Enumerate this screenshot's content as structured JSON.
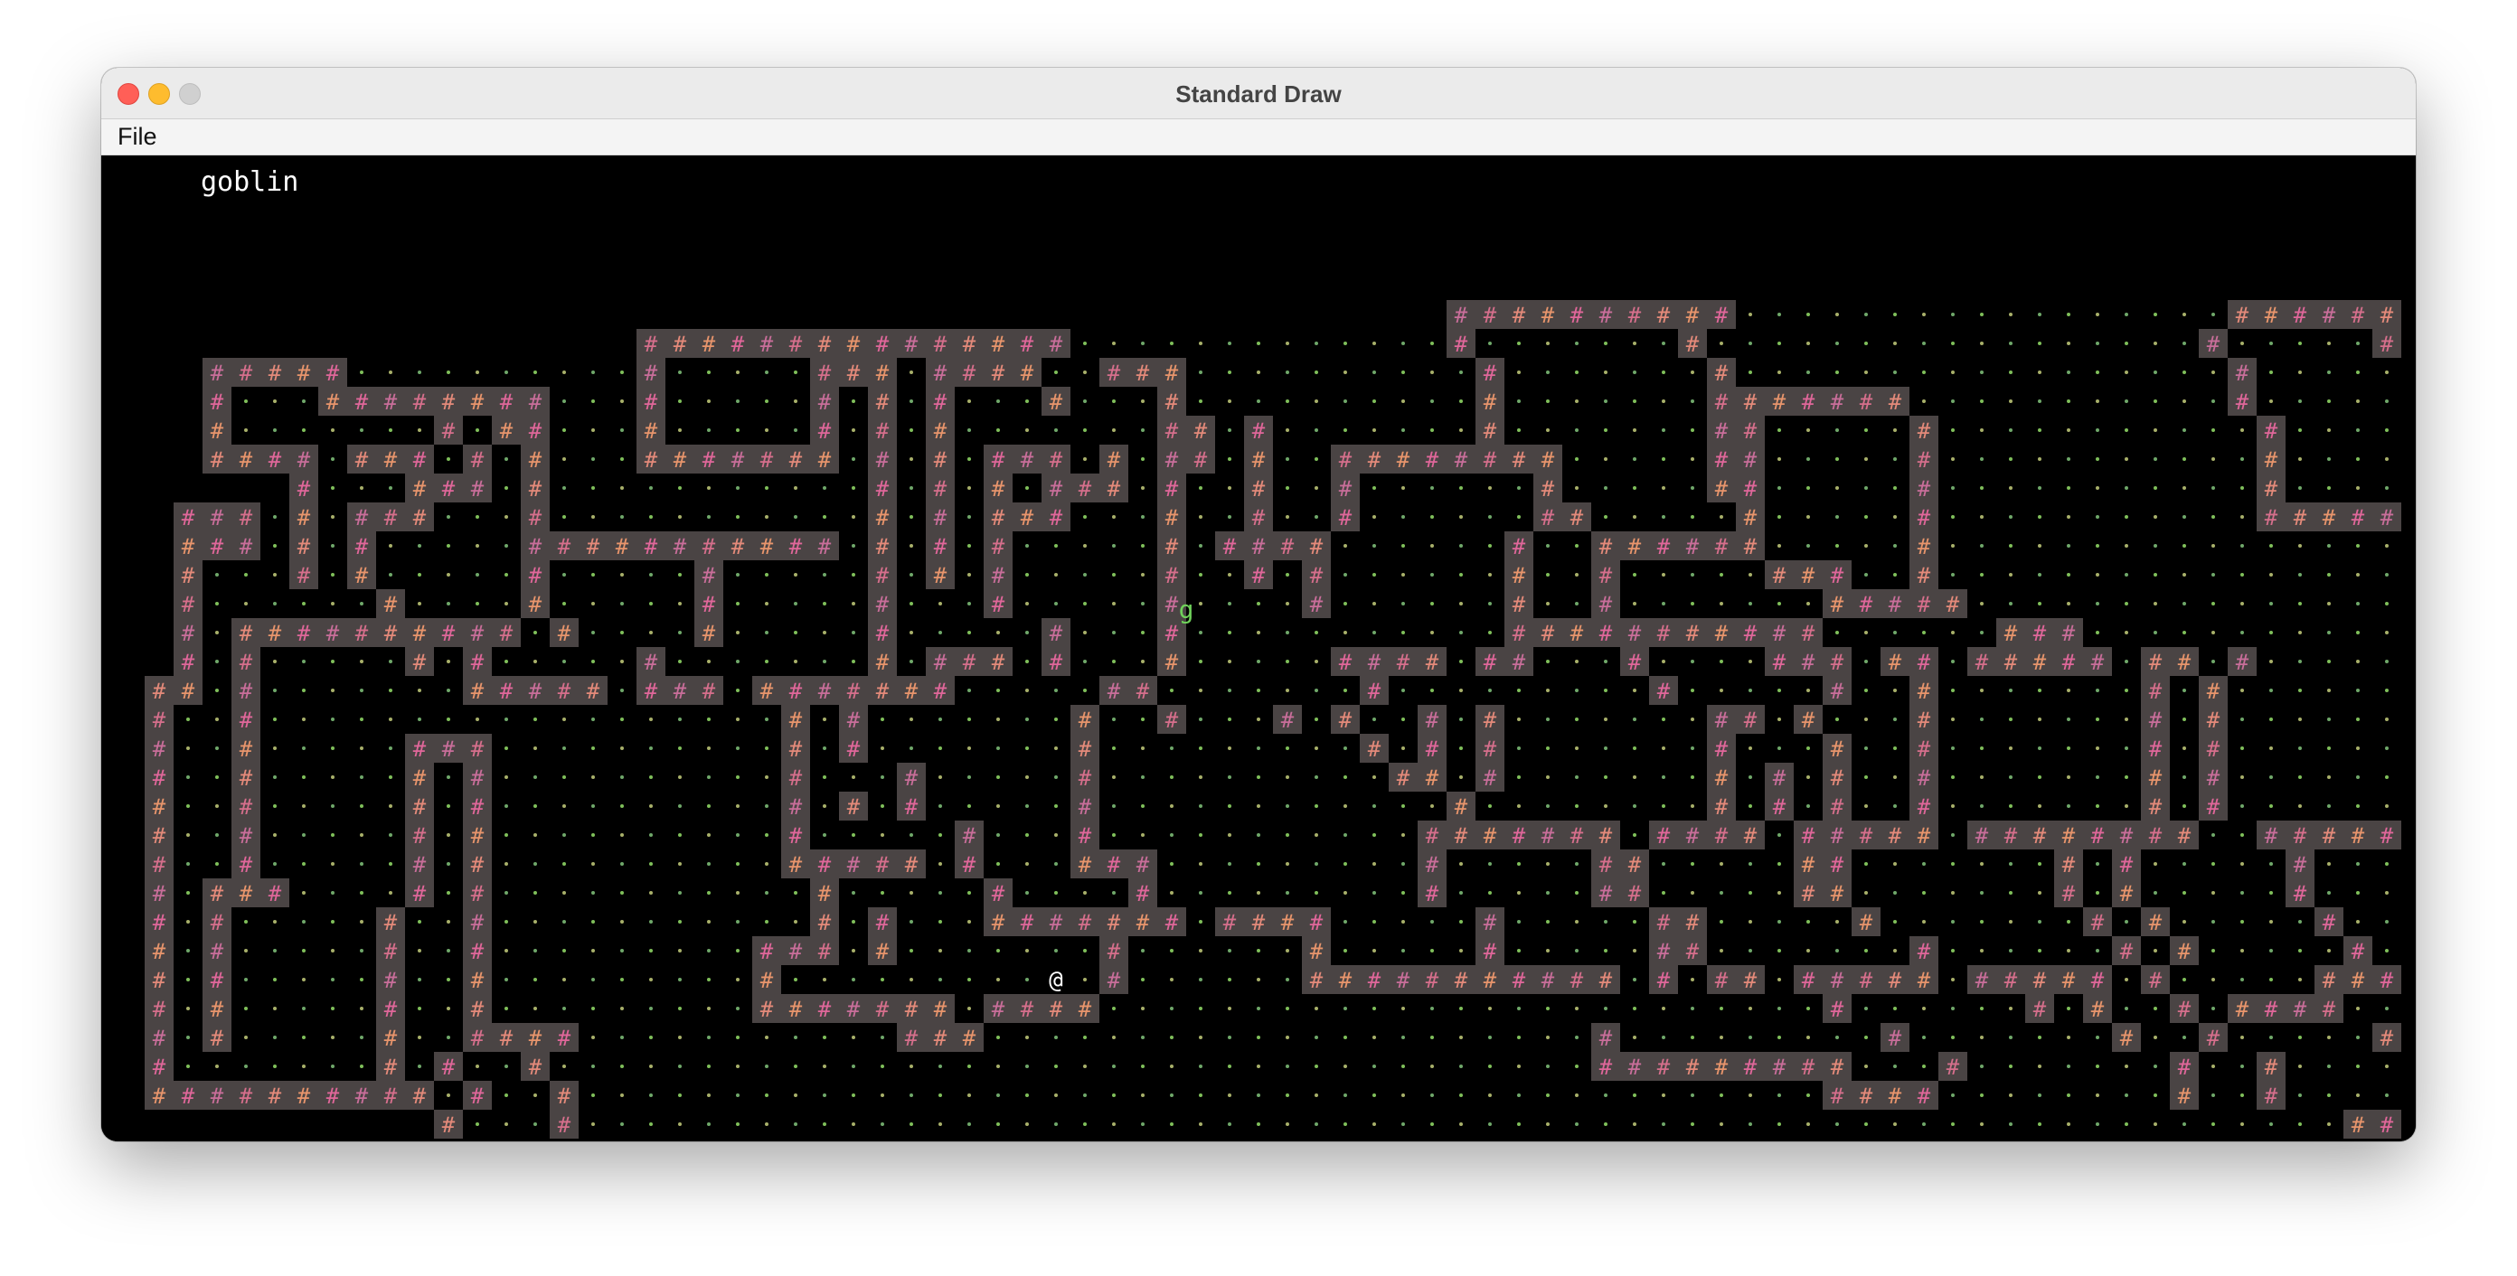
{
  "window": {
    "title": "Standard Draw"
  },
  "menu": {
    "items": [
      {
        "label": "File"
      }
    ]
  },
  "game": {
    "status_text": "goblin",
    "glyphs": {
      "wall": "#",
      "floor": "·",
      "player": "@",
      "monster": "g"
    },
    "colors": {
      "background": "#000000",
      "wall_fill": "#4a4444",
      "wall_glyph_palette": [
        "#e0679a",
        "#d66f8c",
        "#e8956c",
        "#c96e9a",
        "#e48a7a"
      ],
      "floor_dot_palette": [
        "#7fbf5a",
        "#a8b06a",
        "#6fa86a"
      ],
      "player": "#ffffff",
      "monster": "#6fd15a",
      "item": "#f5c518"
    },
    "map": {
      "rows": [
        "..............................................................................",
        "..............................................................................",
        "..............................................................................",
        "..............................................................................",
        "..............................................................................",
        "..............................................##########.................#######....###############",
        "..................###############.............#.......#.................#.....######.............#",
        "...#####..........#.....###.####..###..........#.......#.................#.....#.####.....##......#",
        "...#...########...#.....#.#.#...#...#..........#.......#######...........#.....#.#...##############",
        "...#.......#.##...#.....#.#.#.......##.#.......#.......##.....#...........#.....#.#####.#.####.#####",
        "...####.###.#.#...#######.#.#.###.#.##.#..########.....##.....#...........#.....#.#...#.#...#.......",
        "......#...###.#...........#.#.#.###.#..#..#......#.....##.....#...........#.....#.#####.#...#.......",
        "..###.#.###...#...........#.#.###...#..#..#......##.....#.....#...........######.##.....#...#.......",
        "..###.#.#.....###########.#.#.#.....#.####......#..######.....#.................#######.#####.#####",
        "..#...#.#.....#.....#.....#.#.#.....#..#.#......#..#.....###..#.................#...............#...",
        "..#......#....#.....#.....#...#.....#....#......#..#.......#####.................#.................#",
        "..#.##########.#....#.....#.....#...#...........###########......###..............######.....####.#",
        "..#.#.....#.#.....#.......#.###.#...#.....####.##...#....###.##.#####.##.#.........##...#.#...#.#..#",
        ".##.#.......#####.###.#######.....##.......#.........#.....#..#.......#.#.......######.#.#####.#..#",
        ".#..#..................#.#.......#..#...#.#..#.#.......##.#...#.......#.#........#..........#.#...#",
        ".#..#.....###..........#.#.......#.........#.#.#.......#...#..#.......#.#........#.##########.#....#",
        ".#..#.....#.#..........#...#.....#..........##.#.......#.#.#..#.......#.#........#.#...#.#####.#....#",
        ".#..#.....#.#..........#.#.#.....#............#........#.#.#..#.......#.#.................#.......#",
        ".#..#.....#.#..........#.....#...#...........#######.####.#####.########..#####.#####.#...#.#####.#",
        ".#..#.....#.#..........#####.#...###.........#.....##.....##.......#.#.....#......#.#...#...#.......#",
        ".#.###....#.#...........#.....#....#.........#.....##.....##.......#.#.....#......#.#...#...#.......#",
        ".#.#.....#..#...........#.#...#######.####.....#.....##.....#.......#.#.....#......#.#...#..........#",
        ".#.#.....#..#.........###.#.......#......#.....#.....##.......#......#.#.....#......##...####..#####",
        ".#.#.....#..#.........#.........@.#......###########.#.##.#####.#####.#.....########.....#.......#",
        ".#.#.....#..#.........#######.####.........................#......#.#..#.####.....####...#",
        ".#.#.....#..####...........###.....................#.........#.......#..#.....#......#....#",
        ".#.......#.#..#....................................#########...#.......#..#.....#.#....####",
        ".##########.#..#...........................................####........#..#.....#..#",
        "...........#...#.............................................................#########.#",
        "...........#####.......................................................................###"
      ]
    }
  }
}
